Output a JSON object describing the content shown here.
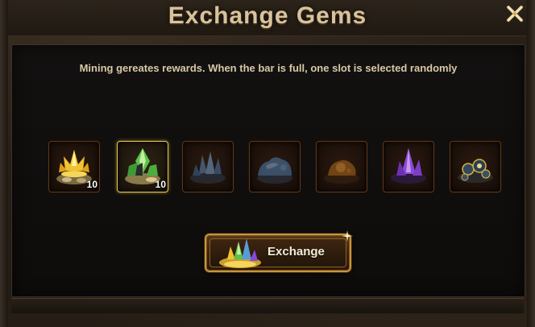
{
  "dialog": {
    "title": "Exchange Gems",
    "close_icon": "close-icon"
  },
  "description": "Mining gereates rewards. When the bar is full, one slot is selected randomly",
  "slots": [
    {
      "icon": "gold-crystal-pile-icon",
      "count": "10",
      "selected": false
    },
    {
      "icon": "green-crystal-pile-icon",
      "count": "10",
      "selected": true
    },
    {
      "icon": "blue-crystal-pile-icon",
      "count": "",
      "selected": false
    },
    {
      "icon": "blue-ore-rock-icon",
      "count": "",
      "selected": false
    },
    {
      "icon": "orange-ore-rock-icon",
      "count": "",
      "selected": false
    },
    {
      "icon": "purple-crystal-pile-icon",
      "count": "",
      "selected": false
    },
    {
      "icon": "dark-gem-cluster-icon",
      "count": "",
      "selected": false
    }
  ],
  "exchange_button": {
    "label": "Exchange",
    "icon": "gem-pile-icon"
  },
  "colors": {
    "title": "#d8c29c",
    "accent_gold": "#e8c84a",
    "button_border": "#c8963c"
  }
}
